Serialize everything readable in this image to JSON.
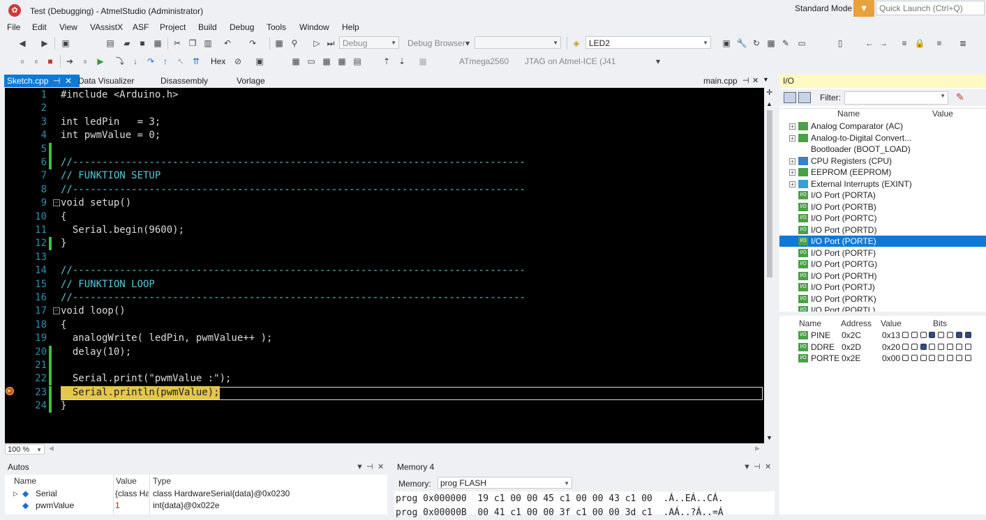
{
  "window": {
    "title": "Test (Debugging) - AtmelStudio (Administrator)",
    "mode": "Standard Mode",
    "quick_launch_placeholder": "Quick Launch (Ctrl+Q)"
  },
  "menu": [
    "File",
    "Edit",
    "View",
    "VAssistX",
    "ASF",
    "Project",
    "Build",
    "Debug",
    "Tools",
    "Window",
    "Help"
  ],
  "toolbar": {
    "config": "Debug",
    "debug_browser": "Debug Browser",
    "target_combo": "LED2",
    "hex_label": "Hex",
    "device": "ATmega2560",
    "tool": "JTAG on Atmel-ICE (J41"
  },
  "editor": {
    "tabs": [
      "Sketch.cpp",
      "Data Visualizer",
      "Disassembly",
      "Vorlage"
    ],
    "right_tab": "main.cpp",
    "zoom": "100 %",
    "lines": [
      {
        "n": "1",
        "text": "#include <Arduino.h>",
        "type": "code"
      },
      {
        "n": "2",
        "text": "",
        "type": "code"
      },
      {
        "n": "3",
        "text": "int ledPin   = 3;",
        "type": "code"
      },
      {
        "n": "4",
        "text": "int pwmValue = 0;",
        "type": "code"
      },
      {
        "n": "5",
        "text": "",
        "type": "code",
        "mark": true
      },
      {
        "n": "6",
        "text": "//-----------------------------------------------------------------------------",
        "type": "comment",
        "mark": true
      },
      {
        "n": "7",
        "text": "// FUNKTION SETUP",
        "type": "comment"
      },
      {
        "n": "8",
        "text": "//-----------------------------------------------------------------------------",
        "type": "comment"
      },
      {
        "n": "9",
        "text": "void setup()",
        "type": "code",
        "fold": true
      },
      {
        "n": "10",
        "text": "{",
        "type": "code"
      },
      {
        "n": "11",
        "text": "  Serial.begin(9600);",
        "type": "code"
      },
      {
        "n": "12",
        "text": "}",
        "type": "code",
        "mark": true
      },
      {
        "n": "13",
        "text": "",
        "type": "code"
      },
      {
        "n": "14",
        "text": "//-----------------------------------------------------------------------------",
        "type": "comment"
      },
      {
        "n": "15",
        "text": "// FUNKTION LOOP",
        "type": "comment"
      },
      {
        "n": "16",
        "text": "//-----------------------------------------------------------------------------",
        "type": "comment"
      },
      {
        "n": "17",
        "text": "void loop()",
        "type": "code",
        "fold": true
      },
      {
        "n": "18",
        "text": "{",
        "type": "code"
      },
      {
        "n": "19",
        "text": "  analogWrite( ledPin, pwmValue++ );",
        "type": "code"
      },
      {
        "n": "20",
        "text": "  delay(10);",
        "type": "code",
        "mark": true
      },
      {
        "n": "21",
        "text": "",
        "type": "code",
        "mark": true
      },
      {
        "n": "22",
        "text": "  Serial.print(\"pwmValue :\");",
        "type": "code",
        "mark": true
      },
      {
        "n": "23",
        "text": "  Serial.println(pwmValue);",
        "type": "highlight",
        "mark": true
      },
      {
        "n": "24",
        "text": "}",
        "type": "code",
        "mark": true
      }
    ]
  },
  "io": {
    "title": "I/O",
    "filter_label": "Filter:",
    "col_name": "Name",
    "col_value": "Value",
    "items": [
      {
        "label": "Analog Comparator (AC)",
        "expand": true,
        "icon": "ADC"
      },
      {
        "label": "Analog-to-Digital Convert...",
        "expand": true,
        "icon": "ADC"
      },
      {
        "label": "Bootloader (BOOT_LOAD)",
        "expand": false,
        "icon": ""
      },
      {
        "label": "CPU Registers (CPU)",
        "expand": true,
        "icon": "CPU"
      },
      {
        "label": "EEPROM (EEPROM)",
        "expand": true,
        "icon": "EE"
      },
      {
        "label": "External Interrupts (EXINT)",
        "expand": true,
        "icon": "INT"
      },
      {
        "label": "I/O Port (PORTA)",
        "expand": false,
        "icon": "I/O"
      },
      {
        "label": "I/O Port (PORTB)",
        "expand": false,
        "icon": "I/O"
      },
      {
        "label": "I/O Port (PORTC)",
        "expand": false,
        "icon": "I/O"
      },
      {
        "label": "I/O Port (PORTD)",
        "expand": false,
        "icon": "I/O"
      },
      {
        "label": "I/O Port (PORTE)",
        "expand": false,
        "icon": "I/O",
        "selected": true
      },
      {
        "label": "I/O Port (PORTF)",
        "expand": false,
        "icon": "I/O"
      },
      {
        "label": "I/O Port (PORTG)",
        "expand": false,
        "icon": "I/O"
      },
      {
        "label": "I/O Port (PORTH)",
        "expand": false,
        "icon": "I/O"
      },
      {
        "label": "I/O Port (PORTJ)",
        "expand": false,
        "icon": "I/O"
      },
      {
        "label": "I/O Port (PORTK)",
        "expand": false,
        "icon": "I/O"
      },
      {
        "label": "I/O Port (PORTL)",
        "expand": false,
        "icon": "I/O"
      }
    ],
    "reg_headers": {
      "name": "Name",
      "address": "Address",
      "value": "Value",
      "bits": "Bits"
    },
    "registers": [
      {
        "name": "PINE",
        "address": "0x2C",
        "value": "0x13",
        "bits": [
          0,
          0,
          0,
          1,
          0,
          0,
          1,
          1
        ]
      },
      {
        "name": "DDRE",
        "address": "0x2D",
        "value": "0x20",
        "bits": [
          0,
          0,
          1,
          0,
          0,
          0,
          0,
          0
        ]
      },
      {
        "name": "PORTE",
        "address": "0x2E",
        "value": "0x00",
        "bits": [
          0,
          0,
          0,
          0,
          0,
          0,
          0,
          0
        ]
      }
    ]
  },
  "autos": {
    "title": "Autos",
    "headers": [
      "Name",
      "Value",
      "Type"
    ],
    "rows": [
      {
        "name": "Serial",
        "value": "{class Har",
        "type": "class HardwareSerial{data}@0x0230"
      },
      {
        "name": "pwmValue",
        "value": "1",
        "type": "int{data}@0x022e"
      }
    ]
  },
  "memory": {
    "title": "Memory 4",
    "memory_label": "Memory:",
    "memory_type": "prog FLASH",
    "lines": [
      "prog 0x000000  19 c1 00 00 45 c1 00 00 43 c1 00  .Á..EÁ..CÁ.",
      "prog 0x00000B  00 41 c1 00 00 3f c1 00 00 3d c1  .AÁ..?Á..=Á"
    ]
  },
  "colors": {
    "accent": "#0e7ad6",
    "editor_bg": "#000000",
    "comment": "#57c8d8",
    "highlight": "#e3c64a",
    "io_header": "#fff9c2"
  }
}
